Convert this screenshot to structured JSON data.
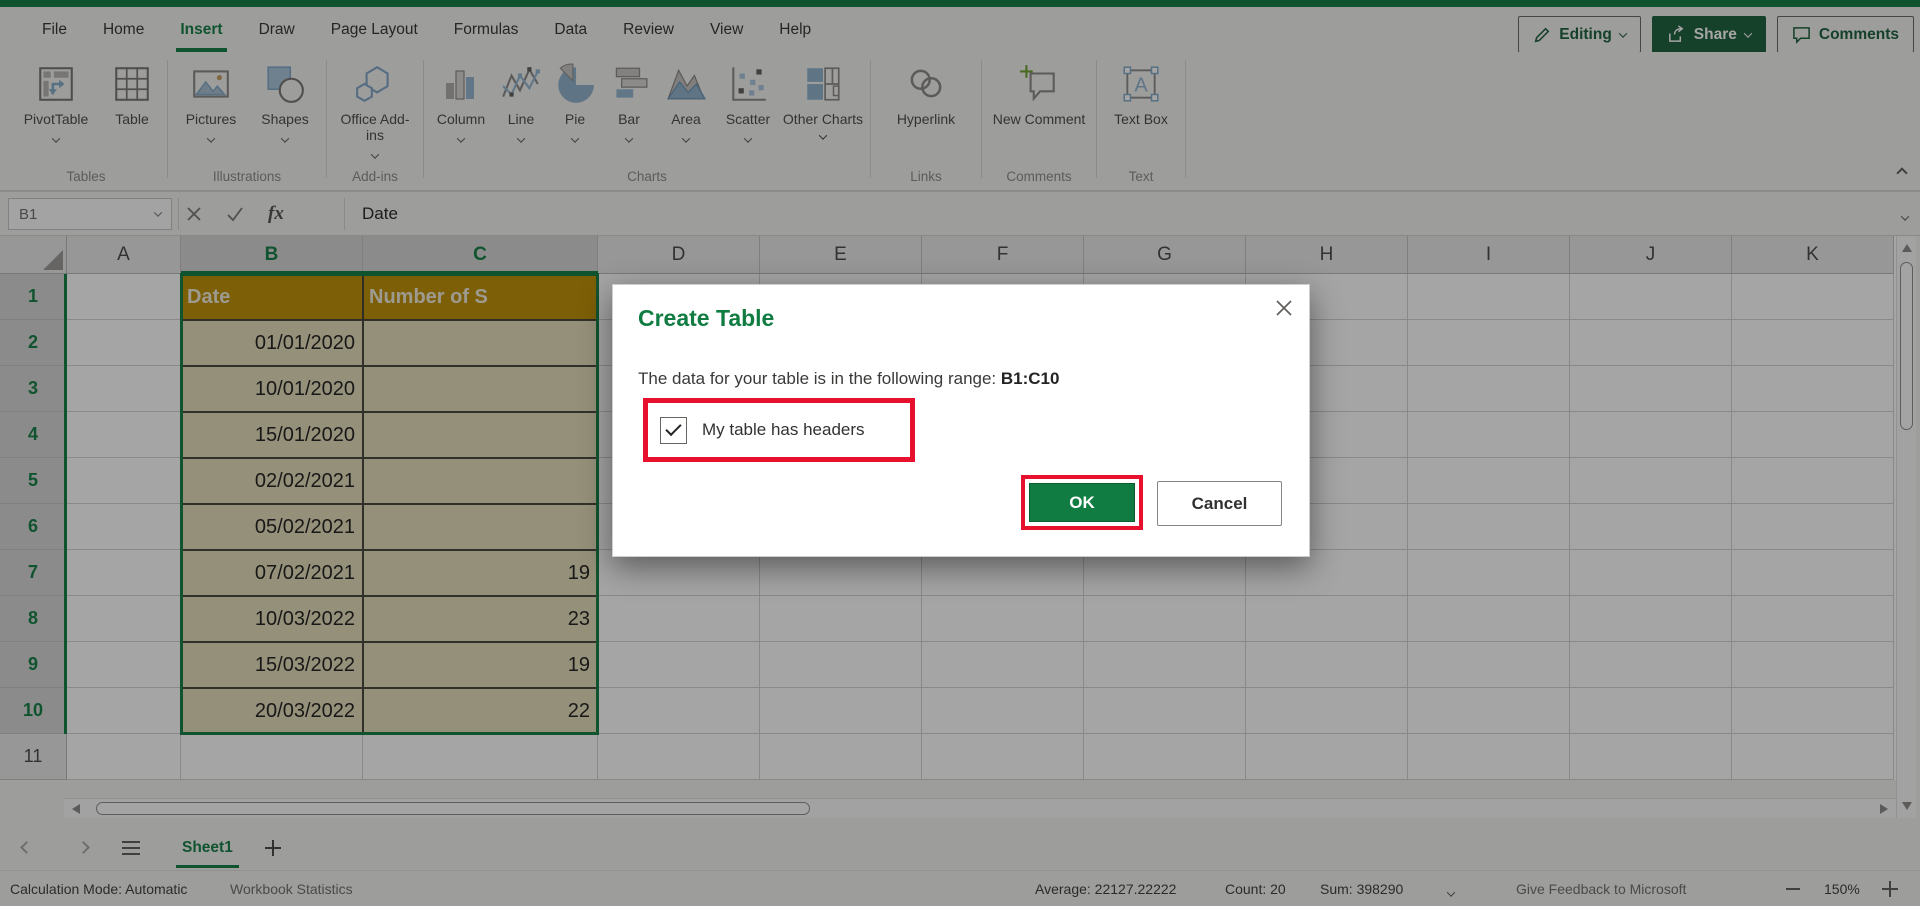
{
  "app": {
    "accent_green": "#107C41",
    "dark_green": "#185C37",
    "annotation_red": "#E8112D",
    "table_header_gold": "#BF8F00",
    "table_row_tan": "#E6DEB8"
  },
  "menubar": {
    "tabs": [
      {
        "label": "File"
      },
      {
        "label": "Home"
      },
      {
        "label": "Insert",
        "active": true
      },
      {
        "label": "Draw"
      },
      {
        "label": "Page Layout"
      },
      {
        "label": "Formulas"
      },
      {
        "label": "Data"
      },
      {
        "label": "Review"
      },
      {
        "label": "View"
      },
      {
        "label": "Help"
      }
    ],
    "right": {
      "editing": "Editing",
      "share": "Share",
      "comments": "Comments"
    }
  },
  "ribbon": {
    "groups": [
      {
        "label": "Tables",
        "items": [
          {
            "label": "PivotTable",
            "dropdown": true
          },
          {
            "label": "Table",
            "dropdown": false
          }
        ]
      },
      {
        "label": "Illustrations",
        "items": [
          {
            "label": "Pictures",
            "dropdown": true
          },
          {
            "label": "Shapes",
            "dropdown": true
          }
        ]
      },
      {
        "label": "Add-ins",
        "items": [
          {
            "label": "Office Add-ins",
            "dropdown": true
          }
        ]
      },
      {
        "label": "Charts",
        "items": [
          {
            "label": "Column",
            "dropdown": true
          },
          {
            "label": "Line",
            "dropdown": true
          },
          {
            "label": "Pie",
            "dropdown": true
          },
          {
            "label": "Bar",
            "dropdown": true
          },
          {
            "label": "Area",
            "dropdown": true
          },
          {
            "label": "Scatter",
            "dropdown": true
          },
          {
            "label": "Other Charts",
            "dropdown": true
          }
        ]
      },
      {
        "label": "Links",
        "items": [
          {
            "label": "Hyperlink",
            "dropdown": false
          }
        ]
      },
      {
        "label": "Comments",
        "items": [
          {
            "label": "New Comment",
            "dropdown": false
          }
        ]
      },
      {
        "label": "Text",
        "items": [
          {
            "label": "Text Box",
            "dropdown": false
          }
        ]
      }
    ]
  },
  "formula_bar": {
    "name_box_value": "B1",
    "fx_label": "fx",
    "formula_value": "Date"
  },
  "grid": {
    "columns": [
      "A",
      "B",
      "C",
      "D",
      "E",
      "F",
      "G",
      "H",
      "I",
      "J",
      "K"
    ],
    "rows": [
      "1",
      "2",
      "3",
      "4",
      "5",
      "6",
      "7",
      "8",
      "9",
      "10",
      "11"
    ],
    "selected_columns": [
      "B",
      "C"
    ],
    "selected_rows": [
      "1",
      "2",
      "3",
      "4",
      "5",
      "6",
      "7",
      "8",
      "9",
      "10"
    ],
    "selection_range": "B1:C10"
  },
  "table": {
    "header_b": "Date",
    "header_c": "Number of S",
    "rows": [
      {
        "row": "2",
        "date": "01/01/2020",
        "value": ""
      },
      {
        "row": "3",
        "date": "10/01/2020",
        "value": ""
      },
      {
        "row": "4",
        "date": "15/01/2020",
        "value": ""
      },
      {
        "row": "5",
        "date": "02/02/2021",
        "value": ""
      },
      {
        "row": "6",
        "date": "05/02/2021",
        "value": ""
      },
      {
        "row": "7",
        "date": "07/02/2021",
        "value": "19"
      },
      {
        "row": "8",
        "date": "10/03/2022",
        "value": "23"
      },
      {
        "row": "9",
        "date": "15/03/2022",
        "value": "19"
      },
      {
        "row": "10",
        "date": "20/03/2022",
        "value": "22"
      }
    ]
  },
  "dialog": {
    "title": "Create Table",
    "body_text": "The data for your table is in the following range: ",
    "range": "B1:C10",
    "checkbox_label": "My table has headers",
    "checkbox_checked": true,
    "ok_label": "OK",
    "cancel_label": "Cancel"
  },
  "sheet_bar": {
    "active_sheet": "Sheet1"
  },
  "status_bar": {
    "calculation_mode": "Calculation Mode: Automatic",
    "workbook_statistics": "Workbook Statistics",
    "average": "Average: 22127.22222",
    "count": "Count: 20",
    "sum": "Sum: 398290",
    "feedback": "Give Feedback to Microsoft",
    "zoom_level": "150%"
  }
}
